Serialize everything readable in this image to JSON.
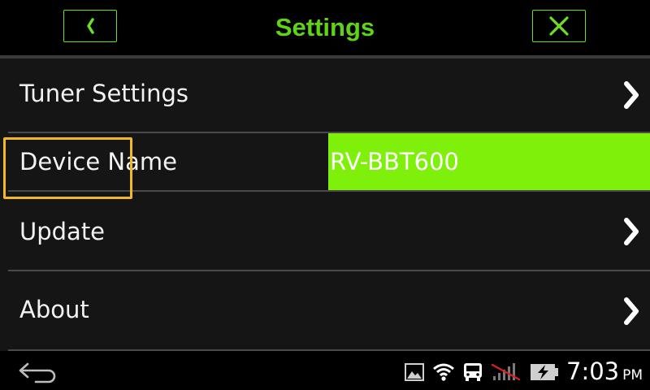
{
  "header": {
    "title": "Settings",
    "back_icon": "chevron-left-icon",
    "close_icon": "close-icon",
    "accent_color": "#5fd417"
  },
  "settings": {
    "items": [
      {
        "label": "Tuner Settings",
        "icon": "chevron-right-icon"
      },
      {
        "label": "Device Name",
        "value": "RV-BBT600",
        "field_color": "#7ff00a"
      },
      {
        "label": "Update",
        "icon": "chevron-right-icon",
        "highlighted": true,
        "highlight_color": "#f2b826"
      },
      {
        "label": "About",
        "icon": "chevron-right-icon"
      }
    ]
  },
  "statusbar": {
    "icons": [
      "back-arrow-icon",
      "image-icon",
      "wifi-icon",
      "bus-icon",
      "no-signal-icon",
      "battery-charging-icon"
    ],
    "time": "7:03",
    "ampm": "PM"
  }
}
